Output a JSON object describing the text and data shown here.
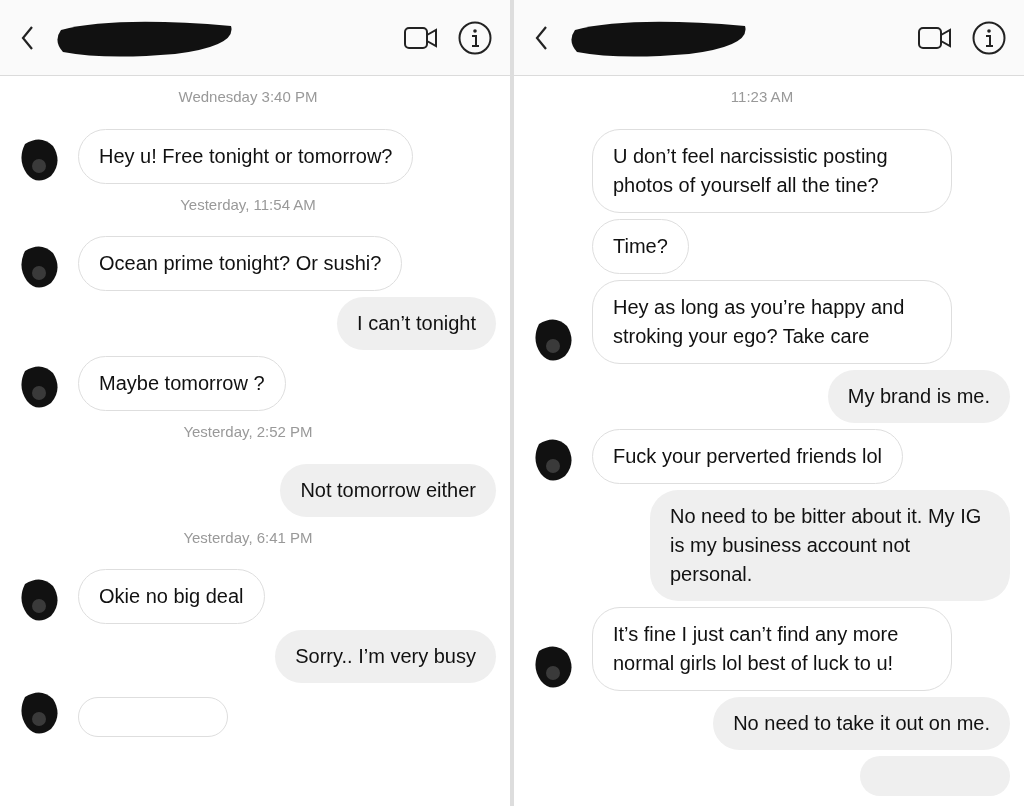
{
  "panes": [
    {
      "header": {
        "redacted_name": true
      },
      "messages": [
        {
          "kind": "timestamp",
          "text": "Wednesday 3:40 PM"
        },
        {
          "kind": "incoming",
          "avatar": true,
          "text": "Hey u! Free tonight or tomorrow?"
        },
        {
          "kind": "timestamp",
          "text": "Yesterday, 11:54 AM"
        },
        {
          "kind": "incoming",
          "avatar": true,
          "text": "Ocean prime tonight? Or sushi?"
        },
        {
          "kind": "outgoing",
          "text": "I can’t tonight"
        },
        {
          "kind": "incoming",
          "avatar": true,
          "text": "Maybe tomorrow ?"
        },
        {
          "kind": "timestamp",
          "text": "Yesterday, 2:52 PM"
        },
        {
          "kind": "outgoing",
          "text": "Not tomorrow either"
        },
        {
          "kind": "timestamp",
          "text": "Yesterday, 6:41 PM"
        },
        {
          "kind": "incoming",
          "avatar": true,
          "text": "Okie no big deal"
        },
        {
          "kind": "outgoing",
          "text": "Sorry.. I’m very busy"
        },
        {
          "kind": "incoming-cut",
          "avatar": true
        }
      ]
    },
    {
      "header": {
        "redacted_name": true
      },
      "messages": [
        {
          "kind": "timestamp",
          "text": "11:23 AM"
        },
        {
          "kind": "incoming",
          "avatar": false,
          "text": "U don’t feel narcissistic posting photos of yourself all the tine?"
        },
        {
          "kind": "incoming",
          "avatar": false,
          "text": "Time?"
        },
        {
          "kind": "incoming",
          "avatar": true,
          "text": "Hey as long as you’re happy and stroking your ego? Take care"
        },
        {
          "kind": "outgoing",
          "text": "My brand is me."
        },
        {
          "kind": "incoming",
          "avatar": true,
          "text": "Fuck your perverted friends lol"
        },
        {
          "kind": "outgoing",
          "text": "No need to be bitter about it. My IG is my business account not personal."
        },
        {
          "kind": "incoming",
          "avatar": true,
          "text": "It’s fine I just can’t find any more normal girls lol best of luck to u!"
        },
        {
          "kind": "outgoing",
          "text": "No need to take it out on me."
        },
        {
          "kind": "outgoing-cut"
        }
      ]
    }
  ]
}
